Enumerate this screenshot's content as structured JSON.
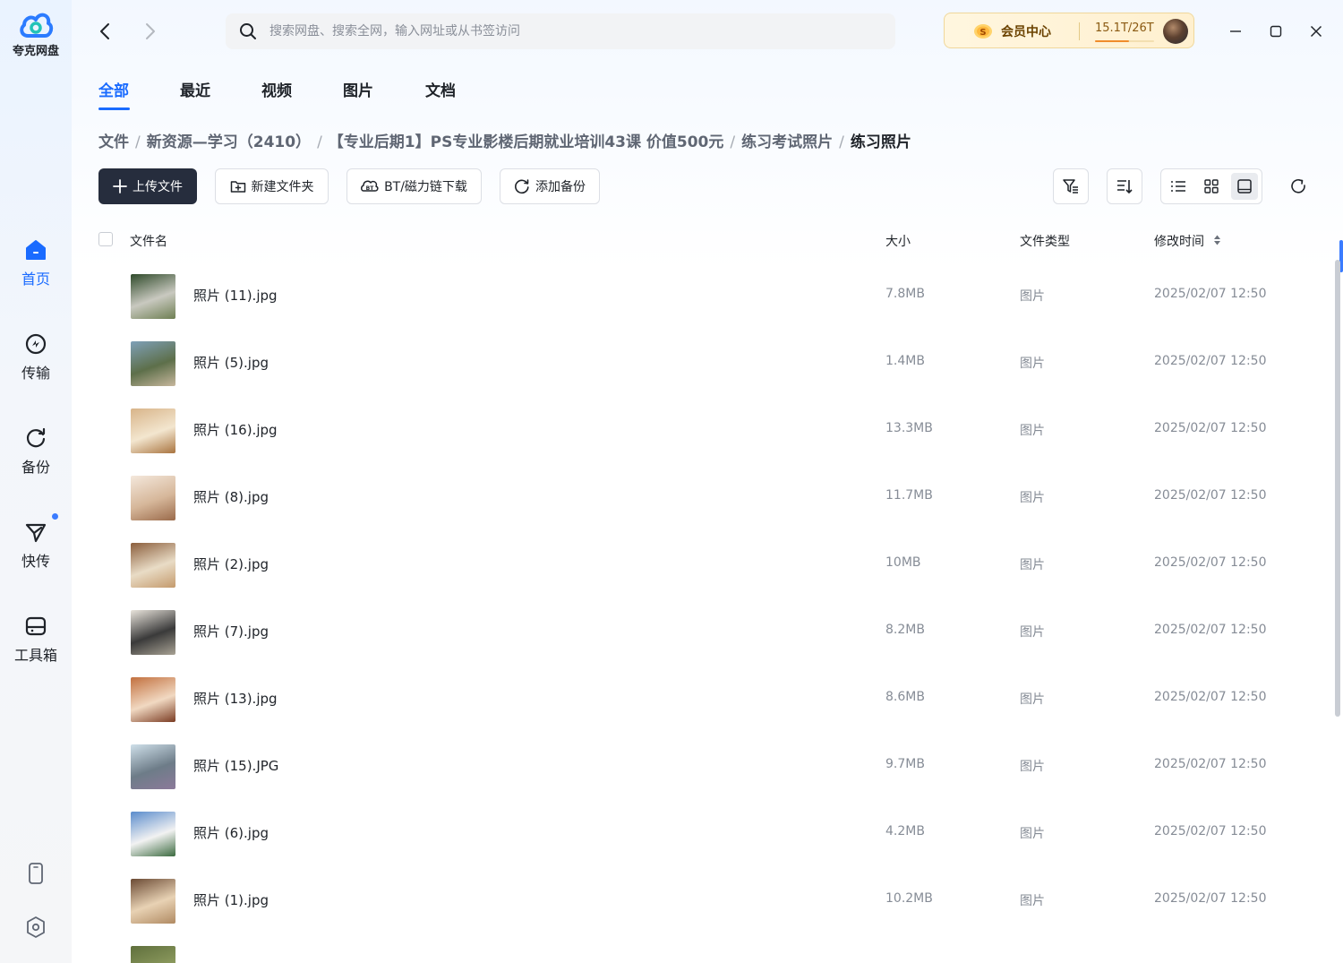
{
  "app": {
    "name": "夸克网盘"
  },
  "sidebar": {
    "items": [
      {
        "label": "首页",
        "icon": "home-icon",
        "active": true
      },
      {
        "label": "传输",
        "icon": "transfer-icon"
      },
      {
        "label": "备份",
        "icon": "backup-icon"
      },
      {
        "label": "快传",
        "icon": "send-icon",
        "has_dot": true
      },
      {
        "label": "工具箱",
        "icon": "toolbox-icon"
      }
    ],
    "bottom": [
      {
        "icon": "phone-icon"
      },
      {
        "icon": "settings-icon"
      }
    ]
  },
  "search": {
    "placeholder": "搜索网盘、搜索全网，输入网址或从书签访问"
  },
  "member": {
    "label": "会员中心",
    "quota": "15.1T/26T",
    "used_fraction": 0.58
  },
  "tabs": [
    {
      "label": "全部",
      "active": true
    },
    {
      "label": "最近"
    },
    {
      "label": "视频"
    },
    {
      "label": "图片"
    },
    {
      "label": "文档"
    }
  ],
  "breadcrumb": [
    "文件",
    "新资源—学习（2410）",
    "【专业后期1】PS专业影楼后期就业培训43课 价值500元",
    "练习考试照片",
    "练习照片"
  ],
  "toolbar": {
    "upload": "上传文件",
    "new_folder": "新建文件夹",
    "bt": "BT/磁力链下载",
    "backup": "添加备份"
  },
  "columns": {
    "name": "文件名",
    "size": "大小",
    "type": "文件类型",
    "modified": "修改时间"
  },
  "files": [
    {
      "name": "照片 (11).jpg",
      "size": "7.8MB",
      "type": "图片",
      "modified": "2025/02/07 12:50",
      "colors": [
        "#2f4a2a",
        "#c9c9c0",
        "#6e7f52"
      ]
    },
    {
      "name": "照片 (5).jpg",
      "size": "1.4MB",
      "type": "图片",
      "modified": "2025/02/07 12:50",
      "colors": [
        "#7fa0b8",
        "#5d6f4a",
        "#c7b79d"
      ]
    },
    {
      "name": "照片 (16).jpg",
      "size": "13.3MB",
      "type": "图片",
      "modified": "2025/02/07 12:50",
      "colors": [
        "#d8b489",
        "#f3e6cf",
        "#a9743f"
      ]
    },
    {
      "name": "照片 (8).jpg",
      "size": "11.7MB",
      "type": "图片",
      "modified": "2025/02/07 12:50",
      "colors": [
        "#f4e8dc",
        "#d6b79a",
        "#9a6a4a"
      ]
    },
    {
      "name": "照片 (2).jpg",
      "size": "10MB",
      "type": "图片",
      "modified": "2025/02/07 12:50",
      "colors": [
        "#8b5e3c",
        "#e9dcc6",
        "#c49a6c"
      ]
    },
    {
      "name": "照片 (7).jpg",
      "size": "8.2MB",
      "type": "图片",
      "modified": "2025/02/07 12:50",
      "colors": [
        "#e9e4dc",
        "#3a3a3a",
        "#a8a294"
      ]
    },
    {
      "name": "照片 (13).jpg",
      "size": "8.6MB",
      "type": "图片",
      "modified": "2025/02/07 12:50",
      "colors": [
        "#c2703e",
        "#f1d9c2",
        "#7a3b22"
      ]
    },
    {
      "name": "照片 (15).JPG",
      "size": "9.7MB",
      "type": "图片",
      "modified": "2025/02/07 12:50",
      "colors": [
        "#cfe0ea",
        "#6d7c88",
        "#8c7a9a"
      ]
    },
    {
      "name": "照片 (6).jpg",
      "size": "4.2MB",
      "type": "图片",
      "modified": "2025/02/07 12:50",
      "colors": [
        "#5a8ccc",
        "#f2f2f2",
        "#3b6a3f"
      ]
    },
    {
      "name": "照片 (1).jpg",
      "size": "10.2MB",
      "type": "图片",
      "modified": "2025/02/07 12:50",
      "colors": [
        "#6b4a34",
        "#e8d2b4",
        "#b08a62"
      ]
    },
    {
      "name": "",
      "size": "",
      "type": "",
      "modified": "",
      "colors": [
        "#5f6f3c",
        "#8c9a5e",
        "#4a5530"
      ]
    }
  ]
}
